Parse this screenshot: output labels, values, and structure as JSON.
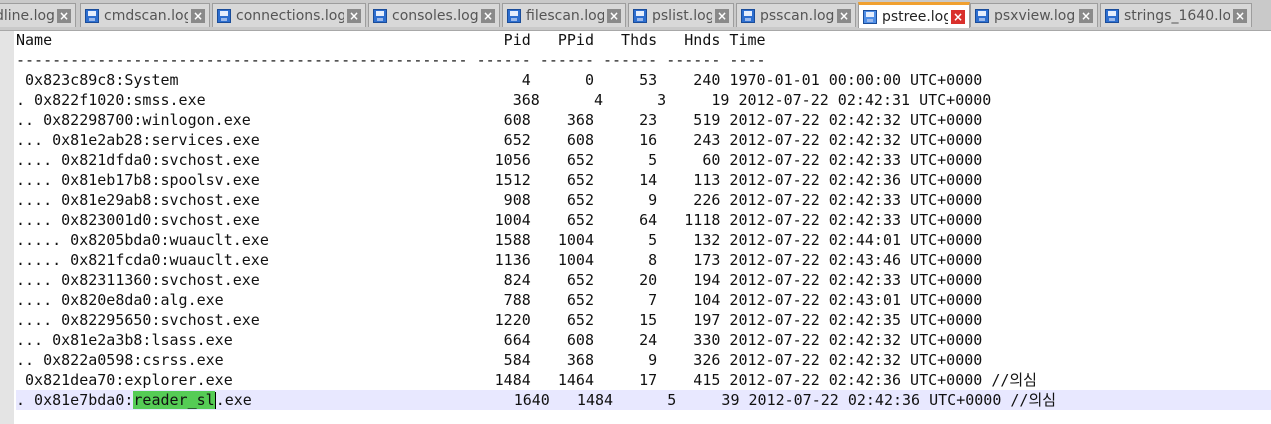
{
  "tabs": [
    {
      "label": "dline.log",
      "active": false
    },
    {
      "label": "cmdscan.log",
      "active": false
    },
    {
      "label": "connections.log",
      "active": false
    },
    {
      "label": "consoles.log",
      "active": false
    },
    {
      "label": "filescan.log",
      "active": false
    },
    {
      "label": "pslist.log",
      "active": false
    },
    {
      "label": "psscan.log",
      "active": false
    },
    {
      "label": "pstree.log",
      "active": true
    },
    {
      "label": "psxview.log",
      "active": false
    },
    {
      "label": "strings_1640.log",
      "active": false
    }
  ],
  "close_glyph": "×",
  "editor": {
    "header": {
      "title": "Name                                                  Pid   PPid   Thds   Hnds Time",
      "rule": "-------------------------------------------------- ------ ------ ------ ------ ----"
    },
    "lines": [
      " 0x823c89c8:System                                      4      0     53    240 1970-01-01 00:00:00 UTC+0000",
      ". 0x822f1020:smss.exe                                  368      4      3     19 2012-07-22 02:42:31 UTC+0000",
      ".. 0x82298700:winlogon.exe                            608    368     23    519 2012-07-22 02:42:32 UTC+0000",
      "... 0x81e2ab28:services.exe                           652    608     16    243 2012-07-22 02:42:32 UTC+0000",
      ".... 0x821dfda0:svchost.exe                          1056    652      5     60 2012-07-22 02:42:33 UTC+0000",
      ".... 0x81eb17b8:spoolsv.exe                          1512    652     14    113 2012-07-22 02:42:36 UTC+0000",
      ".... 0x81e29ab8:svchost.exe                           908    652      9    226 2012-07-22 02:42:33 UTC+0000",
      ".... 0x823001d0:svchost.exe                          1004    652     64   1118 2012-07-22 02:42:33 UTC+0000",
      "..... 0x8205bda0:wuauclt.exe                         1588   1004      5    132 2012-07-22 02:44:01 UTC+0000",
      "..... 0x821fcda0:wuauclt.exe                         1136   1004      8    173 2012-07-22 02:43:46 UTC+0000",
      ".... 0x82311360:svchost.exe                           824    652     20    194 2012-07-22 02:42:33 UTC+0000",
      ".... 0x820e8da0:alg.exe                               788    652      7    104 2012-07-22 02:43:01 UTC+0000",
      ".... 0x82295650:svchost.exe                          1220    652     15    197 2012-07-22 02:42:35 UTC+0000",
      "... 0x81e2a3b8:lsass.exe                              664    608     24    330 2012-07-22 02:42:32 UTC+0000",
      ".. 0x822a0598:csrss.exe                               584    368      9    326 2012-07-22 02:42:32 UTC+0000",
      " 0x821dea70:explorer.exe                             1484   1464     17    415 2012-07-22 02:42:36 UTC+0000 //의심"
    ],
    "current_line": {
      "before": ". 0x81e7bda0:",
      "highlight": "reader_sl",
      "after": ".exe                             1640   1484      5     39 2012-07-22 02:42:36 UTC+0000 //의심"
    }
  },
  "colors": {
    "active_tab_accent": "#f0a030",
    "active_close": "#d9302c",
    "search_highlight": "#55cc55",
    "current_line_bg": "#e8e8ff"
  }
}
